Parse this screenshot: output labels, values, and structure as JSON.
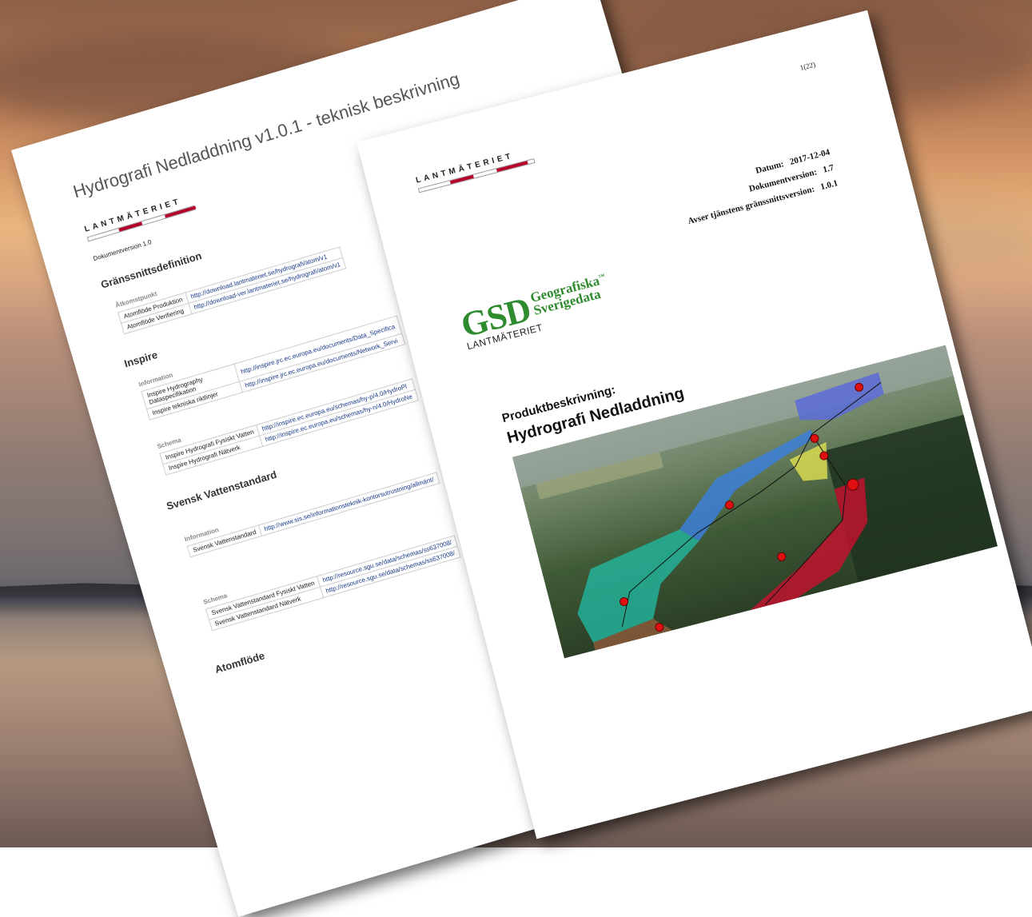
{
  "back_page": {
    "title": "Hydrografi Nedladdning v1.0.1 - teknisk beskrivning",
    "logo_text": "LANTMÄTERIET",
    "doc_version": "Dokumentversion 1.0",
    "sections": {
      "granssnitt": {
        "heading": "Gränssnittsdefinition",
        "sub": "Åtkomstpunkt",
        "rows": [
          {
            "label": "Atomflöde Produktion",
            "url": "http://download.lantmateriet.se/hydrografi/atom/v1"
          },
          {
            "label": "Atomflöde Verifiering",
            "url": "http://download-ver.lantmateriet.se/hydrografi/atom/v1"
          }
        ]
      },
      "inspire": {
        "heading": "Inspire",
        "info_sub": "Information",
        "info_rows": [
          {
            "label": "Inspire Hydrography Dataspecifikation",
            "url": "http://inspire.jrc.ec.europa.eu/documents/Data_Specifica"
          },
          {
            "label": "Inspire tekniska riktlinjer",
            "url": "http://inspire.jrc.ec.europa.eu/documents/Network_Servi"
          }
        ],
        "schema_sub": "Schema",
        "schema_rows": [
          {
            "label": "Inspire Hydrografi Fysiskt Vatten",
            "url": "http://inspire.ec.europa.eu/schemas/hy-p/4.0/HydroPl"
          },
          {
            "label": "Inspire Hydrografi Nätverk",
            "url": "http://inspire.ec.europa.eu/schemas/hy-n/4.0/HydroNe"
          }
        ]
      },
      "svensk": {
        "heading": "Svensk Vattenstandard",
        "info_sub": "Information",
        "info_rows": [
          {
            "label": "Svensk Vattenstandard",
            "url": "http://www.sis.se/informationsteknik-kontorsutrustning/allmänt/"
          }
        ],
        "schema_sub": "Schema",
        "schema_rows": [
          {
            "label": "Svensk Vattenstandard Fysiskt Vatten",
            "url": "http://resource.sgu.se/data/schemas/ss637008/"
          },
          {
            "label": "Svensk Vattenstandard Nätverk",
            "url": "http://resource.sgu.se/data/schemas/ss637008/"
          }
        ]
      },
      "atom": {
        "heading": "Atomflöde"
      }
    }
  },
  "front_page": {
    "page_number": "1(22)",
    "logo_text": "LANTMÄTERIET",
    "meta": [
      {
        "label": "Datum:",
        "value": "2017-12-04"
      },
      {
        "label": "Dokumentversion:",
        "value": "1.7"
      },
      {
        "label": "Avser tjänstens gränssnittsversion:",
        "value": "1.0.1"
      }
    ],
    "gsd": {
      "abbr": "GSD",
      "line1": "Geografiska",
      "tm": "™",
      "line2": "Sverigedata",
      "org": "LANTMÄTERIET"
    },
    "product_label": "Produktbeskrivning:",
    "product_title": "Hydrografi Nedladdning"
  },
  "colors": {
    "brand_red": "#b5002a",
    "gsd_green": "#2e8b2e",
    "link_blue": "#1a3c8c"
  }
}
